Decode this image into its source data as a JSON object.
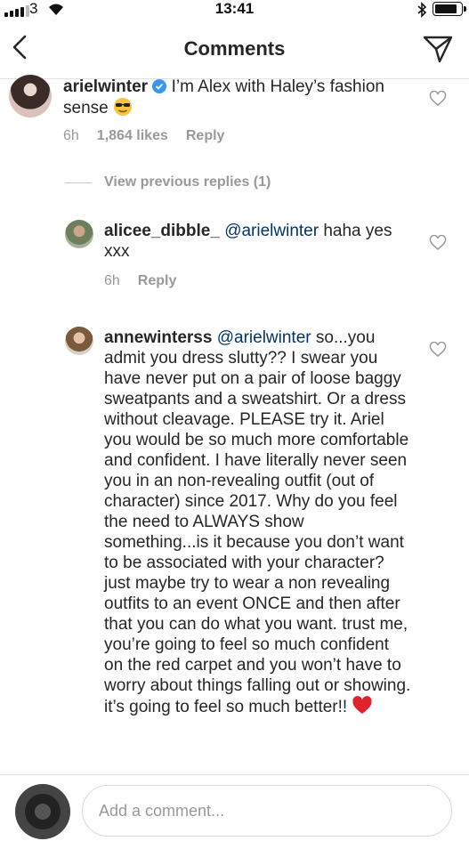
{
  "status": {
    "carrier": "3",
    "time": "13:41",
    "battery_level": 0.85
  },
  "header": {
    "title": "Comments"
  },
  "comments": [
    {
      "user": "arielwinter",
      "verified": true,
      "text": " I’m Alex with Haley’s fashion sense ",
      "emoji": "sunglasses-face",
      "time": "6h",
      "likes": "1,864 likes",
      "reply": "Reply"
    },
    {
      "view_previous": "View previous replies (1)"
    },
    {
      "user": "alicee_dibble_",
      "mention": "@arielwinter",
      "text": " haha yes xxx",
      "time": "6h",
      "reply": "Reply"
    },
    {
      "user": "annewinterss",
      "mention": "@arielwinter",
      "text": " so...you admit you dress slutty?? I swear you have never put on a pair of loose baggy sweatpants and a sweatshirt. Or a dress without cleavage. PLEASE try it. Ariel you would be so much more comfortable and confident. I have literally never seen you in an non-revealing outfit (out of character) since 2017. Why do you feel the need to ALWAYS show something...is it because you don’t want to be associated with your character? just maybe try to wear a non revealing outfits to an event ONCE and then after that you can do what you want. trust me, you’re going to feel so much confident on the red carpet and you won’t have to worry about things falling out or showing. it’s going to feel so much better!! ",
      "emoji": "red-heart"
    }
  ],
  "input": {
    "placeholder": "Add a comment..."
  }
}
